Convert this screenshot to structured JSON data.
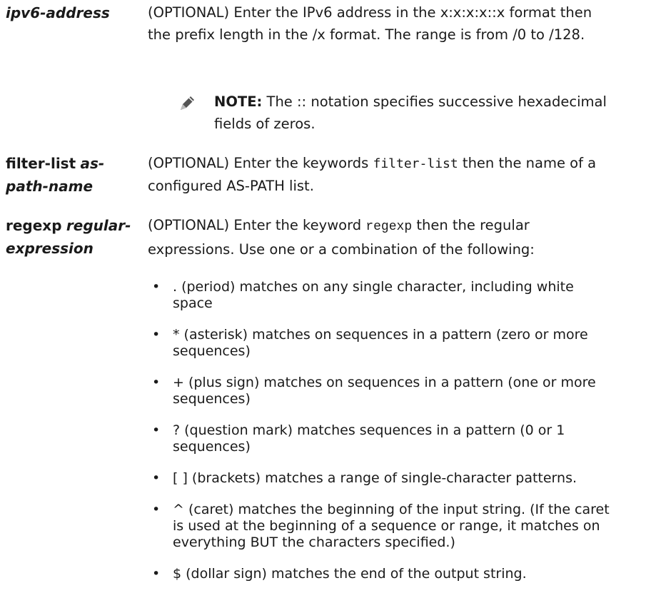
{
  "entries": [
    {
      "term_italic": "ipv6-address",
      "def": "(OPTIONAL) Enter the IPv6 address in the x:x:x:x::x format then the prefix length in the /x format. The range is from /0 to /128."
    },
    {
      "term_kw": "filter-list",
      "term_italic": "as-path-name",
      "def_pre": "(OPTIONAL) Enter the keywords ",
      "def_code": "filter-list",
      "def_post": " then the name of a configured AS-PATH list."
    },
    {
      "term_kw": "regexp",
      "term_italic": "regular-expression",
      "def_pre": "(OPTIONAL) Enter the keyword ",
      "def_code": "regexp",
      "def_post": " then the regular expressions. Use one or a combination of the following:"
    }
  ],
  "note": {
    "label": "NOTE:",
    "text": " The :: notation specifies successive hexadecimal fields of zeros."
  },
  "bullet_marker": "•",
  "bullets": [
    ". (period) matches on any single character, including white space",
    "* (asterisk) matches on sequences in a pattern (zero or more sequences)",
    "+ (plus sign) matches on sequences in a pattern (one or more sequences)",
    "? (question mark) matches sequences in a pattern (0 or 1 sequences)",
    "[ ] (brackets) matches a range of single-character patterns.",
    "^ (caret) matches the beginning of the input string. (If the caret is used at the beginning of a sequence or range, it matches on everything BUT the characters specified.)",
    "$ (dollar sign) matches the end of the output string."
  ]
}
